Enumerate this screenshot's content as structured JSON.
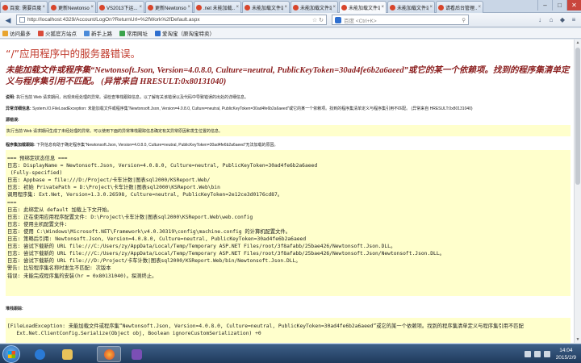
{
  "browser": {
    "tabs": [
      {
        "label": "百度: 需要百度",
        "active": false
      },
      {
        "label": "更新Newtonso...",
        "active": false
      },
      {
        "label": "VS2013下运...",
        "active": false
      },
      {
        "label": "更新Newtonso...",
        "active": false
      },
      {
        "label": ".net 未能加载...",
        "active": false
      },
      {
        "label": "未能加载文件或程...",
        "active": false
      },
      {
        "label": "未能加载文件或程...",
        "active": false
      },
      {
        "label": "未能加载文件或程...",
        "active": true
      },
      {
        "label": "未能加载文件或程...",
        "active": false
      },
      {
        "label": "请看后台管理...",
        "active": false
      }
    ],
    "window_controls": {
      "minimize": "–",
      "maximize": "□",
      "close": "✕"
    },
    "url": "http://localhost:4329/Account/LogOn?ReturnUrl=%2fWork%2fDefault.aspx",
    "search_placeholder": "百度 <Ctrl+K>",
    "bookmarks": [
      "访问最多",
      "火狐官方站点",
      "新手上路",
      "常用网址",
      "爱淘宝（原淘宝特卖）"
    ]
  },
  "page": {
    "title": "“/”应用程序中的服务器错误。",
    "error_heading": "未能加载文件或程序集“Newtonsoft.Json, Version=4.0.8.0, Culture=neutral, PublicKeyToken=30ad4fe6b2a6aeed”或它的某一个依赖项。找到的程序集清单定义与程序集引用不匹配。 (异常来自 HRESULT:0x80131040)",
    "description_label": "说明:",
    "description_text": "执行当前 Web 请求期间，出现未经处理的异常。请检查堆栈跟踪信息，以了解有关该错误以及代码中导致错误的出处的详细信息。",
    "exception_label": "异常详细信息:",
    "exception_text": "System.IO.FileLoadException: 未能加载文件或程序集“Newtonsoft.Json, Version=4.0.8.0, Culture=neutral, PublicKeyToken=30ad4fe6b2a6aeed”或它的某一个依赖项。找到的程序集清单定义与程序集引用不匹配。 (异常来自 HRESULT:0x80131040)",
    "source_error_label": "源错误:",
    "source_error_text": "执行当前 Web 请求期间生成了未经处理的异常。可以使用下面的异常堆栈跟踪信息确定有关异常原因和发生位置的信息。",
    "assembly_log_label": "程序集加载跟踪:",
    "assembly_log_text": "下列信息有助于确定程序集“Newtonsoft.Json, Version=4.0.8.0, Culture=neutral, PublicKeyToken=30ad4fe6b2a6aeed”无法加载的原因。",
    "binding_log": "=== 预绑定状态信息 ===\n日志: DisplayName = Newtonsoft.Json, Version=4.0.8.0, Culture=neutral, PublicKeyToken=30ad4fe6b2a6aeed\n (Fully-specified)\n日志: Appbase = file:///D:/Project/卡车计数|图表sql2000/KSReport.Web/\n日志: 初始 PrivatePath = D:\\Project\\卡车计数|图表sql2000\\KSReport.Web\\bin\n调用程序集: Ext.Net, Version=1.3.0.26598, Culture=neutral, PublicKeyToken=2e12ce3d0176cd87。\n===\n日志: 此绑定从 default 加载上下文开始。\n日志: 正在使用应用程序配置文件: D:\\Project\\卡车计数|图表sql2000\\KSReport.Web\\web.config\n日志: 使用主机配置文件:\n日志: 使用 C:\\Windows\\Microsoft.NET\\Framework\\v4.0.30319\\config\\machine.config 的计算机配置文件。\n日志: 策略后引用: Newtonsoft.Json, Version=4.0.8.0, Culture=neutral, PublicKeyToken=30ad4fe6b2a6aeed\n日志: 尝试下载新的 URL file:///C:/Users/zy/AppData/Local/Temp/Temporary ASP.NET Files/root/3f8afabb/25bae426/Newtonsoft.Json.DLL。\n日志: 尝试下载新的 URL file:///C:/Users/zy/AppData/Local/Temp/Temporary ASP.NET Files/root/3f8afabb/25bae426/Newtonsoft.Json/Newtonsoft.Json.DLL。\n日志: 尝试下载新的 URL file:///D:/Project/卡车计数|图表sql2000/KSReport.Web/bin/Newtonsoft.Json.DLL。\n警告: 比较程序集名称时发生不匹配: 次版本\n错误: 未能完成程序集的安装(hr = 0x80131040)。探测终止。",
    "stack_label": "堆栈跟踪:",
    "stack_trace": "[FileLoadException: 未能加载文件或程序集“Newtonsoft.Json, Version=4.0.8.0, Culture=neutral, PublicKeyToken=30ad4fe6b2a6aeed”或它的某一个依赖项。找到的程序集清单定义与程序集引用不匹配\n   Ext.Net.ClientConfig.Serialize(Object obj, Boolean ignoreCustomSerialization) +0"
  },
  "taskbar": {
    "apps": [
      "internet-explorer",
      "folder",
      "firefox",
      "visual-studio"
    ],
    "time": "14:04",
    "date": "2015/2/9"
  },
  "colors": {
    "error_title": "#c0392b",
    "error_heading": "#8b1f1f",
    "highlight_box": "#ffffcc",
    "taskbar": "#1f3a5c"
  }
}
